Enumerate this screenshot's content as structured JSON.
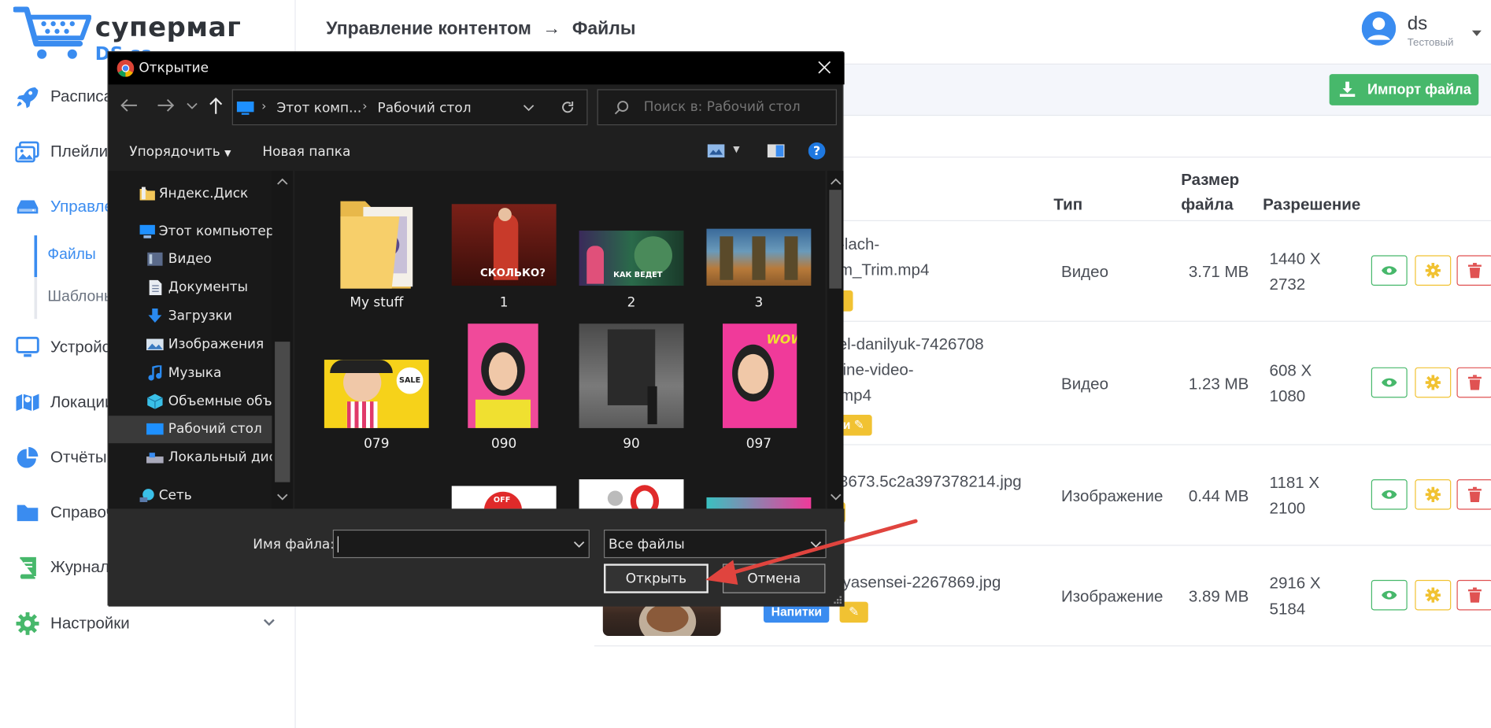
{
  "app": {
    "logo_title": "супермаг",
    "logo_sub": "DS.ss"
  },
  "sidebar": {
    "items": [
      {
        "label": "Расписание",
        "icon": "rocket-icon"
      },
      {
        "label": "Плейлисты",
        "icon": "images-icon"
      },
      {
        "label": "Управление контентом",
        "icon": "drive-icon"
      },
      {
        "label": "Устройства",
        "icon": "monitor-icon"
      },
      {
        "label": "Локации",
        "icon": "map-icon"
      },
      {
        "label": "Отчёты",
        "icon": "pie-chart-icon"
      },
      {
        "label": "Справочники",
        "icon": "folder-icon"
      },
      {
        "label": "Журнал",
        "icon": "book-icon"
      },
      {
        "label": "Настройки",
        "icon": "gear-icon"
      }
    ],
    "subitems": [
      {
        "label": "Файлы",
        "active": true
      },
      {
        "label": "Шаблоны",
        "active": false
      }
    ]
  },
  "header": {
    "crumb_parent": "Управление контентом",
    "crumb_arrow": "→",
    "crumb_current": "Файлы",
    "user_name": "ds",
    "user_role": "Тестовый"
  },
  "toolbar": {
    "import_label": "Импорт файла"
  },
  "table": {
    "headers": {
      "type": "Тип",
      "size_line1": "Размер",
      "size_line2": "файла",
      "resolution": "Разрешение"
    },
    "rows": [
      {
        "name_lines": [
          "n-lach-",
          "rim_Trim.mp4"
        ],
        "type": "Видео",
        "size": "3.71 MB",
        "res_w": "1440 X",
        "res_h": "2732"
      },
      {
        "name_lines": [
          "vel-danilyuk-7426708",
          "nline-video-",
          ").mp4"
        ],
        "type": "Видео",
        "size": "1.23 MB",
        "res_w": "608 X",
        "res_h": "1080",
        "tag": "ги"
      },
      {
        "name_lines": [
          "83673.5c2a397378214.jpg"
        ],
        "type": "Изображение",
        "size": "0.44 MB",
        "res_w": "1181 X",
        "res_h": "2100"
      },
      {
        "name_lines": [
          "styasensei-2267869.jpg"
        ],
        "type": "Изображение",
        "size": "3.89 MB",
        "res_w": "2916 X",
        "res_h": "5184",
        "tag": "Напитки"
      }
    ]
  },
  "dialog": {
    "title": "Открытие",
    "path_part1": "Этот комп...",
    "path_part2": "Рабочий стол",
    "search_placeholder": "Поиск в: Рабочий стол",
    "organize": "Упорядочить",
    "new_folder": "Новая папка",
    "tree": [
      {
        "label": "Яндекс.Диск",
        "icon": "yandex-disk-icon"
      },
      {
        "label": "Этот компьютер",
        "icon": "computer-icon"
      },
      {
        "label": "Видео",
        "icon": "video-folder-icon"
      },
      {
        "label": "Документы",
        "icon": "documents-icon"
      },
      {
        "label": "Загрузки",
        "icon": "downloads-icon"
      },
      {
        "label": "Изображения",
        "icon": "pictures-icon"
      },
      {
        "label": "Музыка",
        "icon": "music-icon"
      },
      {
        "label": "Объемные объе",
        "icon": "3d-objects-icon"
      },
      {
        "label": "Рабочий стол",
        "icon": "desktop-icon"
      },
      {
        "label": "Локальный диск",
        "icon": "local-disk-icon"
      },
      {
        "label": "Сеть",
        "icon": "network-icon"
      }
    ],
    "files": [
      {
        "label": "My stuff"
      },
      {
        "label": "1"
      },
      {
        "label": "2"
      },
      {
        "label": "3"
      },
      {
        "label": "079"
      },
      {
        "label": "090"
      },
      {
        "label": "90"
      },
      {
        "label": "097"
      }
    ],
    "thumb_caption_1": "СКОЛЬКО?",
    "thumb_caption_2": "КАК ВЕДЕТ",
    "thumb_caption_079": "SALE",
    "thumb_caption_097": "WOW",
    "thumb_caption_off": "OFF",
    "filename_label": "Имя файла:",
    "filename_value": "",
    "filetype": "Все файлы",
    "open_label": "Открыть",
    "cancel_label": "Отмена"
  },
  "colors": {
    "accent": "#3a8cf0",
    "success": "#47b86b",
    "warning": "#f1c232",
    "danger": "#e05252",
    "annotation_arrow": "#e0443e"
  }
}
